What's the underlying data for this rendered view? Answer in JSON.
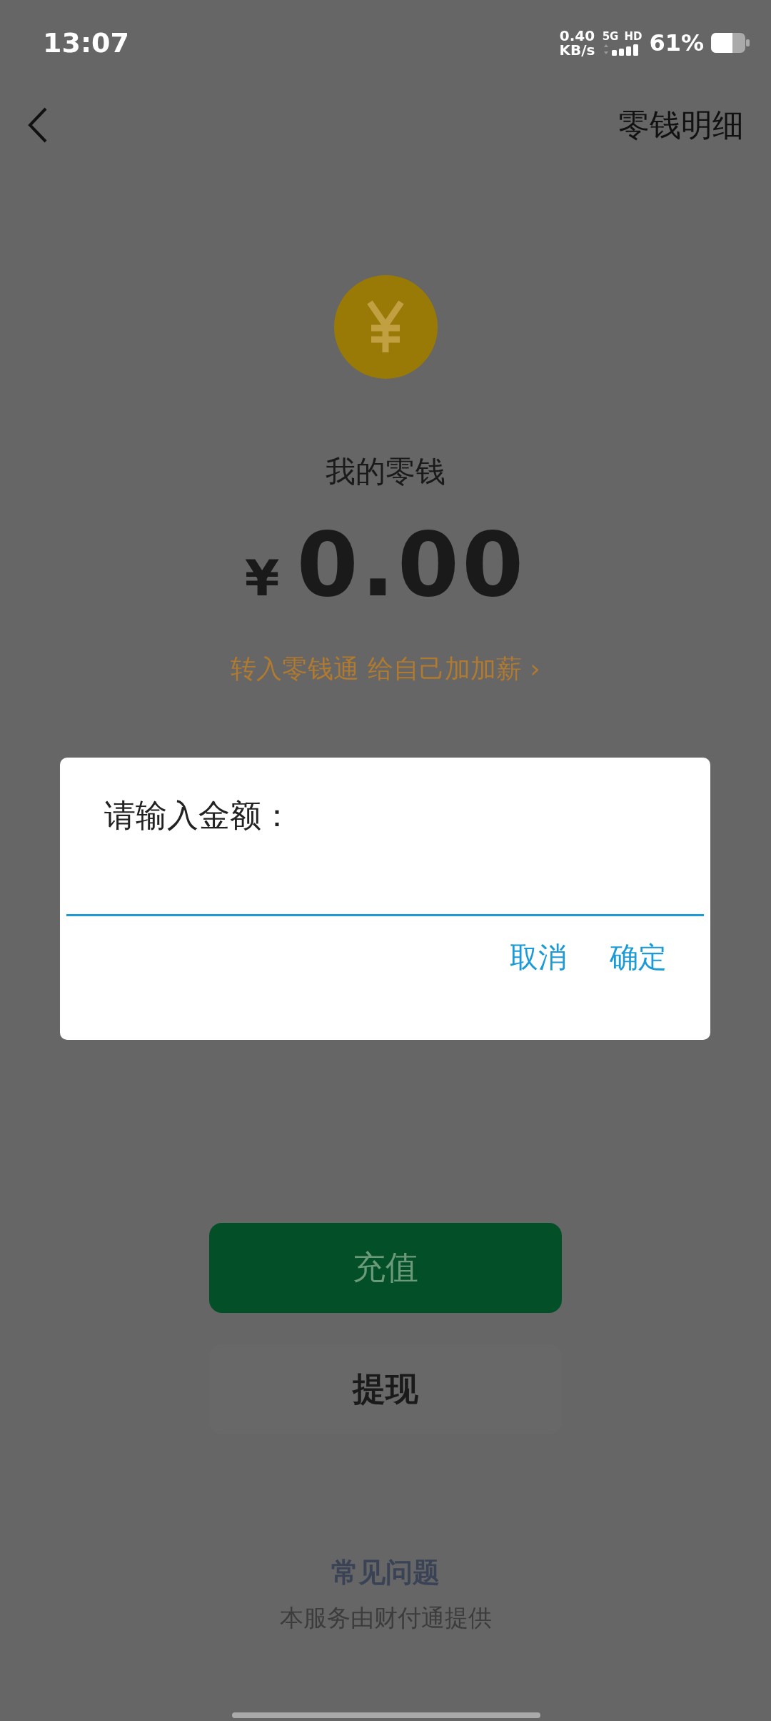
{
  "status_bar": {
    "time": "13:07",
    "net_speed": "0.40",
    "net_unit": "KB/s",
    "network": "5G",
    "hd": "HD",
    "battery": "61%"
  },
  "nav": {
    "title": "零钱明细"
  },
  "balance": {
    "label": "我的零钱",
    "currency": "¥",
    "amount": "0.00",
    "promo": "转入零钱通 给自己加加薪",
    "promo_arrow": "›"
  },
  "dialog": {
    "title": "请输入金额：",
    "buttons": [
      "取消",
      "确定"
    ]
  },
  "actions": [
    "充值",
    "提现"
  ],
  "footer": {
    "faq": "常见问题",
    "provider": "本服务由财付通提供"
  }
}
